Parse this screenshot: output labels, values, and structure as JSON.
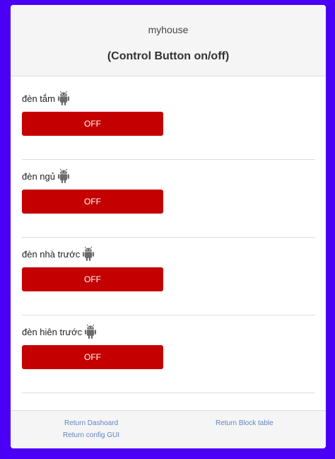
{
  "header": {
    "app_title": "myhouse",
    "subtitle": "(Control Button on/off)"
  },
  "devices": [
    {
      "label": "đèn tắm",
      "icon": "android-icon",
      "state": "OFF"
    },
    {
      "label": "đèn ngủ",
      "icon": "android-icon",
      "state": "OFF"
    },
    {
      "label": "đèn nhà trước",
      "icon": "android-icon",
      "state": "OFF"
    },
    {
      "label": "đèn hiên trước",
      "icon": "android-icon",
      "state": "OFF"
    }
  ],
  "footer": {
    "return_dashboard": "Return Dashoard",
    "return_block_table": "Return Block table",
    "return_config_gui": "Return config GUI"
  },
  "colors": {
    "background": "#4a00f5",
    "button_off": "#c40000",
    "link": "#5f86c4"
  }
}
